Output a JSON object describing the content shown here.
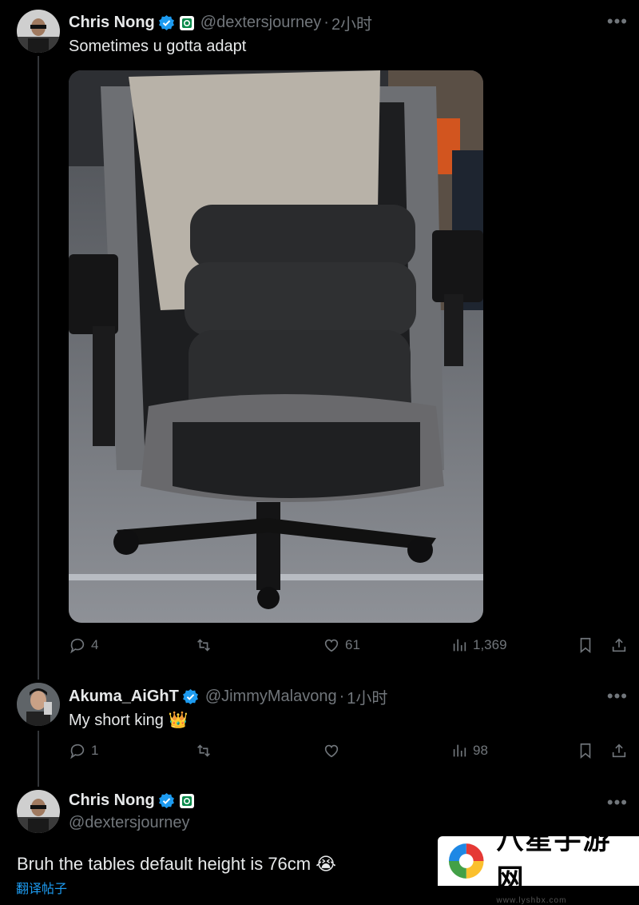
{
  "tweet1": {
    "display_name": "Chris Nong",
    "handle": "@dextersjourney",
    "separator": "·",
    "time": "2小时",
    "text": "Sometimes u gotta adapt",
    "media_icon": "office-chair-photo",
    "actions": {
      "replies": "4",
      "retweets": "",
      "likes": "61",
      "views": "1,369"
    }
  },
  "reply1": {
    "display_name": "Akuma_AiGhT",
    "handle": "@JimmyMalavong",
    "separator": "·",
    "time": "1小时",
    "text": "My short king",
    "emoji": "👑",
    "actions": {
      "replies": "1",
      "retweets": "",
      "likes": "",
      "views": "98"
    }
  },
  "tweet2": {
    "display_name": "Chris Nong",
    "handle": "@dextersjourney",
    "text": "Bruh the tables default height is 76cm",
    "emoji": "😭",
    "translate_link": "翻译帖子"
  },
  "watermark": {
    "title": "八星手游网",
    "url": "www.lyshbx.com"
  },
  "colors": {
    "background": "#000000",
    "text_primary": "#e7e9ea",
    "text_secondary": "#71767b",
    "verified_blue": "#1d9bf0",
    "thread_line": "#333639"
  }
}
